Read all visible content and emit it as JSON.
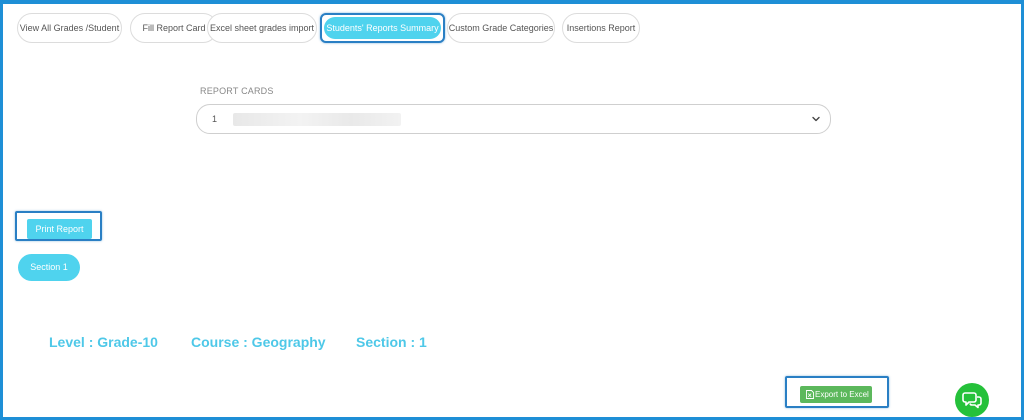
{
  "tabs": [
    {
      "label": "View All Grades /Student"
    },
    {
      "label": "Fill Report Card"
    },
    {
      "label": "Excel sheet grades import"
    },
    {
      "label": "Students' Reports Summary"
    },
    {
      "label": "Custom Grade Categories"
    },
    {
      "label": "Insertions Report"
    }
  ],
  "active_tab_index": 3,
  "report_cards": {
    "label": "REPORT CARDS",
    "selected_value": "1",
    "icon": "chevron-down-icon"
  },
  "actions": {
    "print_label": "Print Report",
    "section_label": "Section 1",
    "export_label": "Export to Excel",
    "export_icon": "file-excel-icon"
  },
  "info": {
    "level": "Level : Grade-10",
    "course": "Course : Geography",
    "section": "Section : 1"
  },
  "chat": {
    "icon": "chat-bubbles-icon"
  },
  "colors": {
    "accent": "#4fd3ee",
    "frame": "#1e8fd6",
    "info_text": "#4ec8e8",
    "export_green": "#5cb85c",
    "chat_green": "#25c13a"
  }
}
